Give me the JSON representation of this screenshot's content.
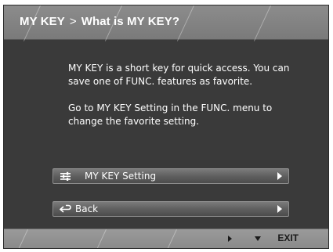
{
  "header": {
    "root": "MY KEY",
    "separator": ">",
    "title": "What is MY KEY?"
  },
  "body": {
    "paragraph1": "MY KEY is a short key for quick access. You can save one of FUNC. features as favorite.",
    "paragraph2": "Go to MY KEY Setting in the FUNC. menu to change the favorite setting."
  },
  "menu": {
    "items": [
      {
        "label": "MY KEY Setting",
        "icon": "sliders-icon"
      },
      {
        "label": "Back",
        "icon": "return-arrow-icon"
      }
    ]
  },
  "footer": {
    "next_icon": "triangle-right-icon",
    "down_icon": "triangle-down-icon",
    "exit_label": "EXIT"
  },
  "colors": {
    "panel_bg": "#3a3a3a",
    "header_bg": "#8c8c8c",
    "footer_bg": "#9a9a9a",
    "text": "#ffffff"
  }
}
